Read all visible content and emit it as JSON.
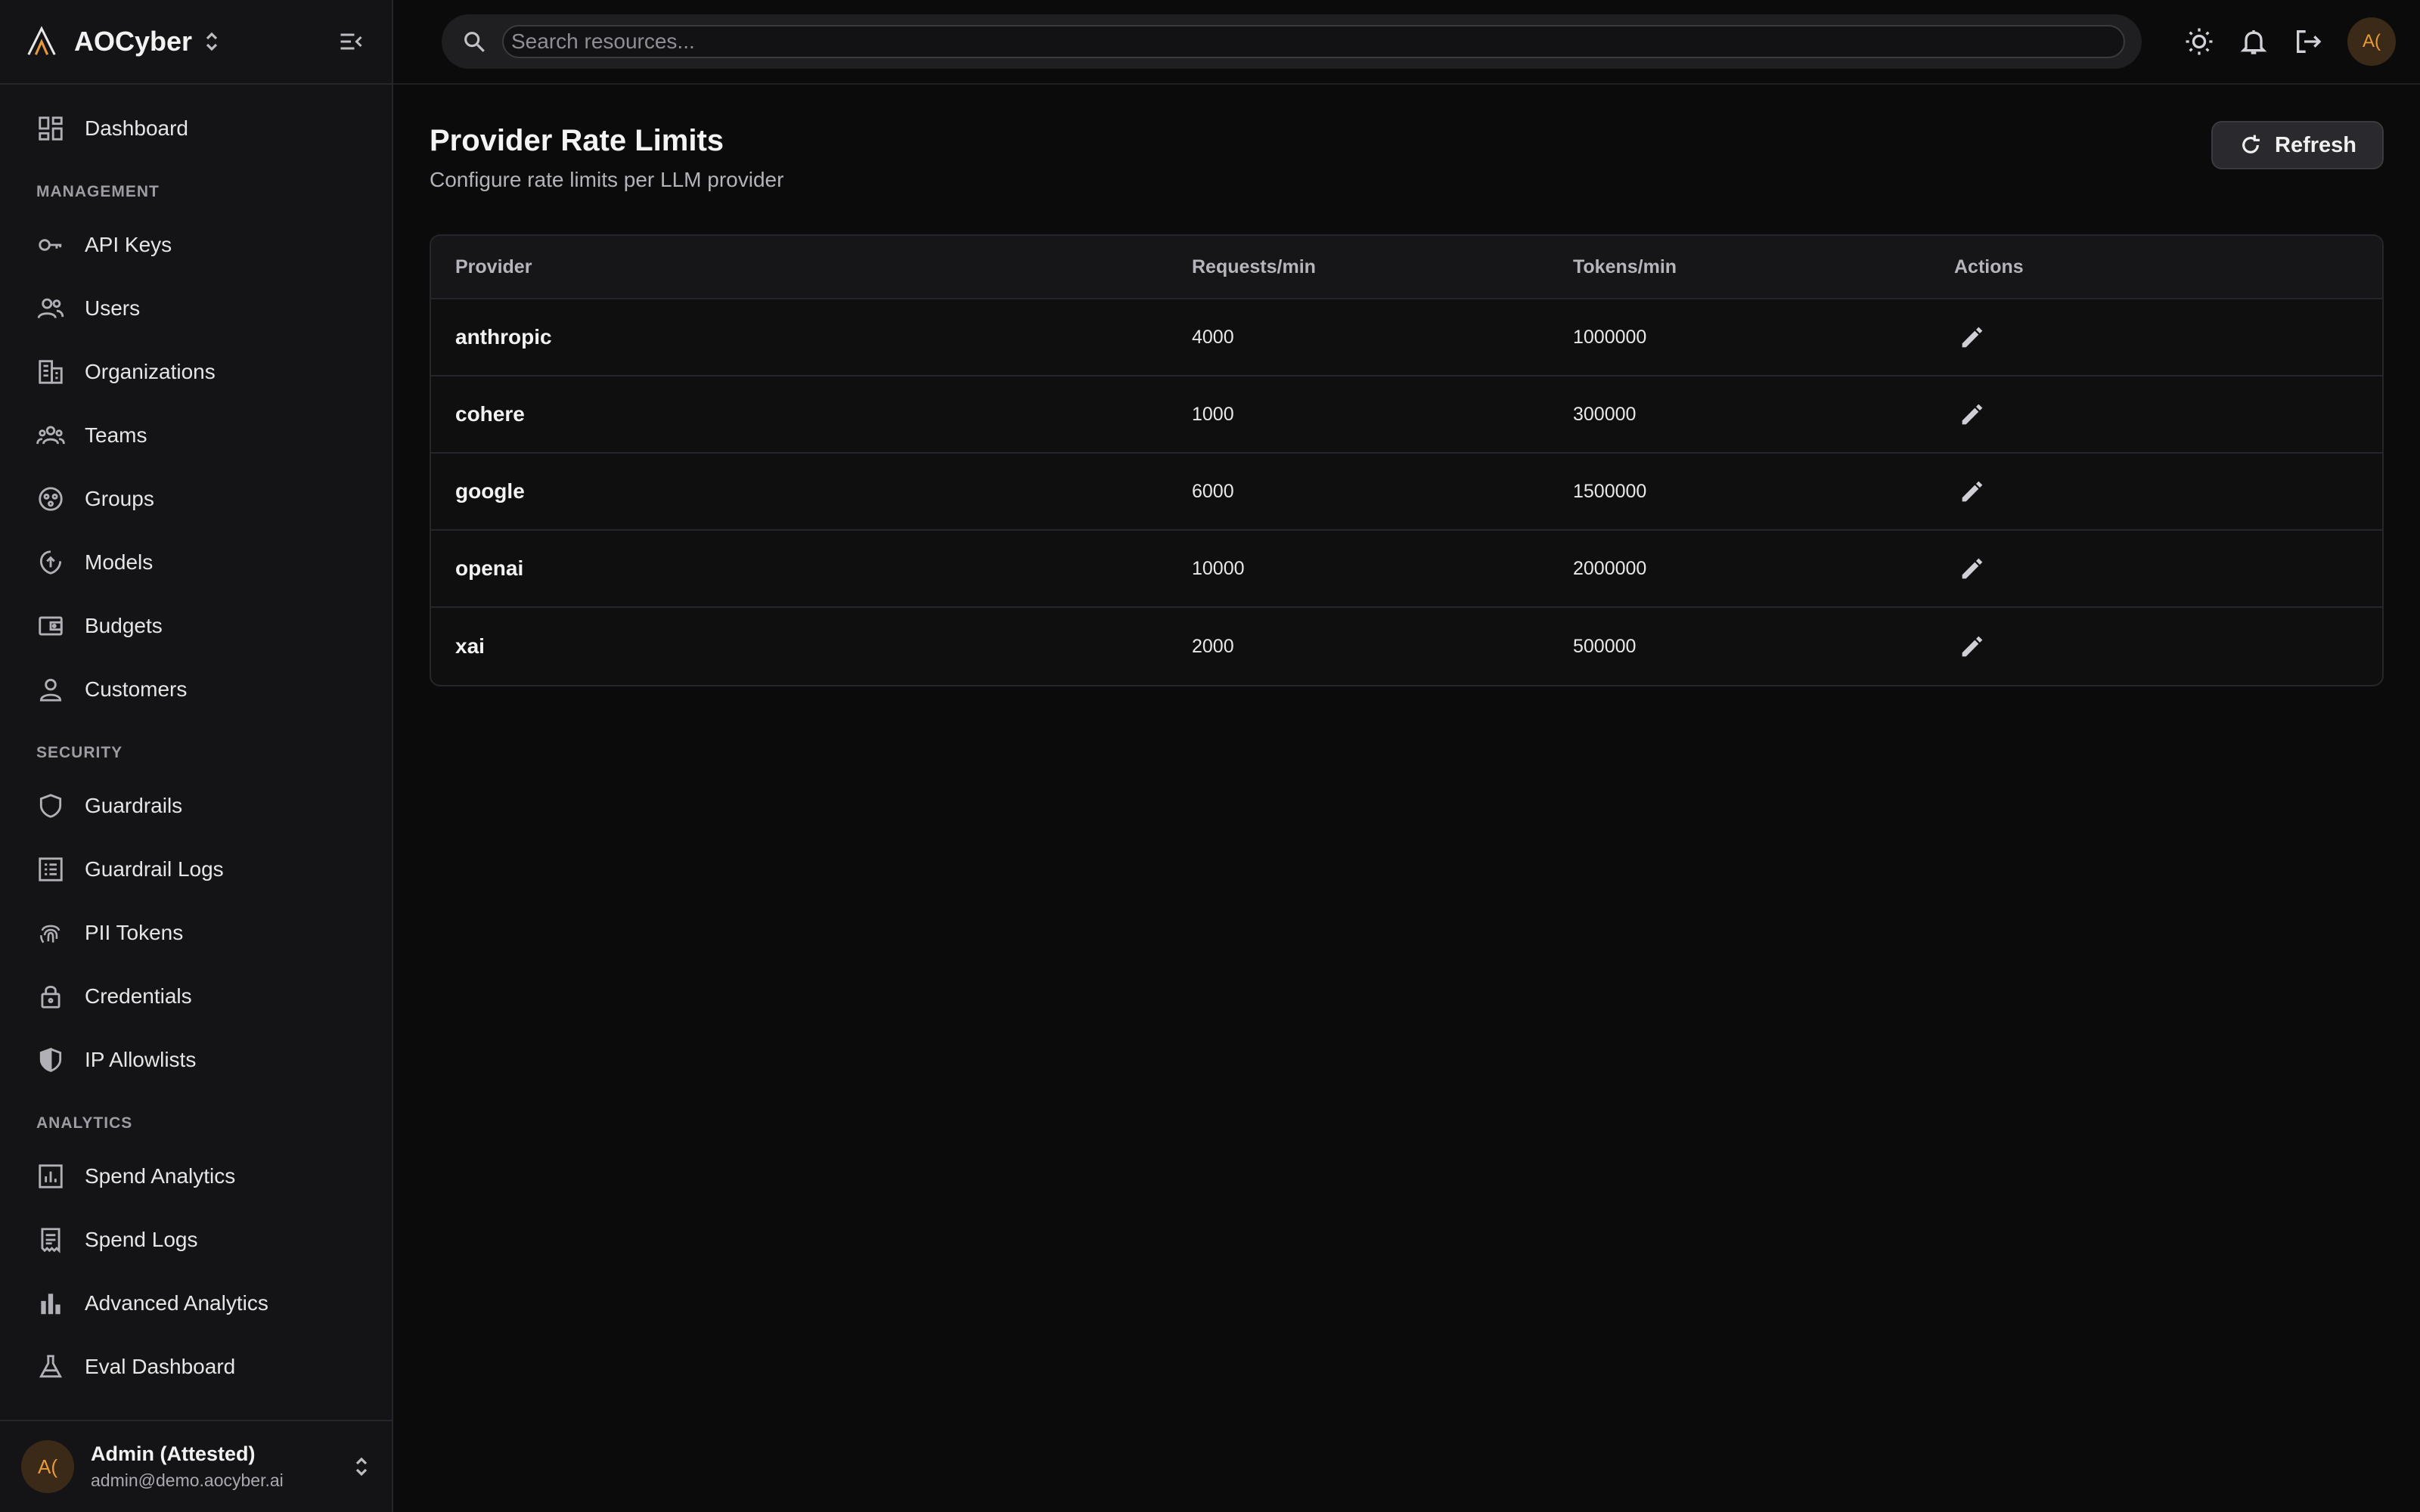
{
  "brand": {
    "name": "AOCyber"
  },
  "sidebar": {
    "dashboard": "Dashboard",
    "sections": {
      "management": "MANAGEMENT",
      "security": "SECURITY",
      "analytics": "ANALYTICS"
    },
    "management_items": [
      "API Keys",
      "Users",
      "Organizations",
      "Teams",
      "Groups",
      "Models",
      "Budgets",
      "Customers"
    ],
    "security_items": [
      "Guardrails",
      "Guardrail Logs",
      "PII Tokens",
      "Credentials",
      "IP Allowlists"
    ],
    "analytics_items": [
      "Spend Analytics",
      "Spend Logs",
      "Advanced Analytics",
      "Eval Dashboard"
    ]
  },
  "user": {
    "initials": "A(",
    "name": "Admin (Attested)",
    "email": "admin@demo.aocyber.ai"
  },
  "search": {
    "placeholder": "Search resources..."
  },
  "page": {
    "title": "Provider Rate Limits",
    "subtitle": "Configure rate limits per LLM provider",
    "refresh_label": "Refresh"
  },
  "table": {
    "headers": [
      "Provider",
      "Requests/min",
      "Tokens/min",
      "Actions"
    ],
    "rows": [
      {
        "provider": "anthropic",
        "requests": "4000",
        "tokens": "1000000"
      },
      {
        "provider": "cohere",
        "requests": "1000",
        "tokens": "300000"
      },
      {
        "provider": "google",
        "requests": "6000",
        "tokens": "1500000"
      },
      {
        "provider": "openai",
        "requests": "10000",
        "tokens": "2000000"
      },
      {
        "provider": "xai",
        "requests": "2000",
        "tokens": "500000"
      }
    ]
  },
  "colors": {
    "accent": "#e89a3a",
    "background": "#0b0b0b",
    "sidebar": "#141416"
  }
}
